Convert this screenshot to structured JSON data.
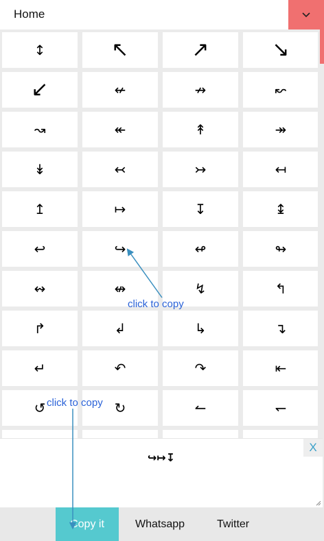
{
  "header": {
    "title": "Home",
    "dropdown_icon": "chevron-down-icon"
  },
  "grid": {
    "symbols": [
      "↕",
      "↖",
      "↗",
      "↘",
      "↙",
      "↚",
      "↛",
      "↜",
      "↝",
      "↞",
      "↟",
      "↠",
      "↡",
      "↢",
      "↣",
      "↤",
      "↥",
      "↦",
      "↧",
      "↨",
      "↩",
      "↪",
      "↫",
      "↬",
      "↭",
      "↮",
      "↯",
      "↰",
      "↱",
      "↲",
      "↳",
      "↴",
      "↵",
      "↶",
      "↷",
      "⇤",
      "↺",
      "↻",
      "↼",
      "↽",
      "↾",
      "↿",
      "⇀",
      "⇁"
    ]
  },
  "output": {
    "text": "↪↦↧",
    "clear_label": "X"
  },
  "actions": {
    "copy_label": "Copy it",
    "whatsapp_label": "Whatsapp",
    "twitter_label": "Twitter"
  },
  "annotations": {
    "label_1": "click to copy",
    "label_2": "click to copy"
  },
  "colors": {
    "accent": "#55c9cf",
    "header_button": "#f07070",
    "annotation": "#2a62d8",
    "arrow": "#3a8fbf"
  }
}
